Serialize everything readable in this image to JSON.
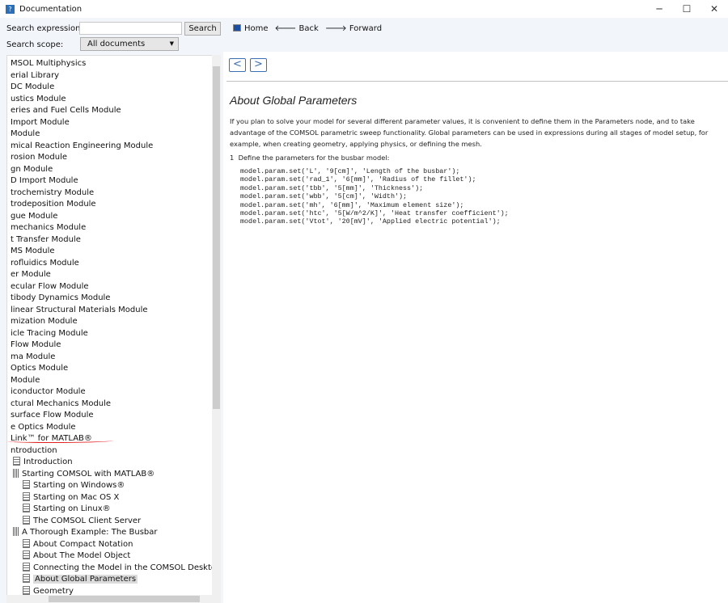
{
  "window": {
    "title": "Documentation",
    "icon": "help-icon",
    "controls": [
      "─",
      "☐",
      "✕"
    ]
  },
  "search": {
    "expression_label": "Search expression:",
    "expression_value": "",
    "button": "Search",
    "scope_label": "Search scope:",
    "scope_value": "All documents"
  },
  "nav": {
    "home": "Home",
    "back": "Back",
    "forward": "Forward",
    "back_arrow": "🡐",
    "forward_arrow": "🡒",
    "prev": "<",
    "next": ">"
  },
  "tree": {
    "items": [
      {
        "label": "MSOL Multiphysics",
        "indent": 0,
        "icon": ""
      },
      {
        "label": "erial Library",
        "indent": 0,
        "icon": ""
      },
      {
        "label": "DC Module",
        "indent": 0,
        "icon": ""
      },
      {
        "label": "ustics Module",
        "indent": 0,
        "icon": ""
      },
      {
        "label": "eries and Fuel Cells Module",
        "indent": 0,
        "icon": ""
      },
      {
        "label": " Import Module",
        "indent": 0,
        "icon": ""
      },
      {
        "label": " Module",
        "indent": 0,
        "icon": ""
      },
      {
        "label": "mical Reaction Engineering Module",
        "indent": 0,
        "icon": ""
      },
      {
        "label": "rosion Module",
        "indent": 0,
        "icon": ""
      },
      {
        "label": "gn Module",
        "indent": 0,
        "icon": ""
      },
      {
        "label": "D Import Module",
        "indent": 0,
        "icon": ""
      },
      {
        "label": "trochemistry Module",
        "indent": 0,
        "icon": ""
      },
      {
        "label": "trodeposition Module",
        "indent": 0,
        "icon": ""
      },
      {
        "label": "gue Module",
        "indent": 0,
        "icon": ""
      },
      {
        "label": "mechanics Module",
        "indent": 0,
        "icon": ""
      },
      {
        "label": "t Transfer Module",
        "indent": 0,
        "icon": ""
      },
      {
        "label": "MS Module",
        "indent": 0,
        "icon": ""
      },
      {
        "label": "rofluidics Module",
        "indent": 0,
        "icon": ""
      },
      {
        "label": "er Module",
        "indent": 0,
        "icon": ""
      },
      {
        "label": "ecular Flow Module",
        "indent": 0,
        "icon": ""
      },
      {
        "label": "tibody Dynamics Module",
        "indent": 0,
        "icon": ""
      },
      {
        "label": "linear Structural Materials Module",
        "indent": 0,
        "icon": ""
      },
      {
        "label": "mization Module",
        "indent": 0,
        "icon": ""
      },
      {
        "label": "icle Tracing Module",
        "indent": 0,
        "icon": ""
      },
      {
        "label": " Flow Module",
        "indent": 0,
        "icon": ""
      },
      {
        "label": "ma Module",
        "indent": 0,
        "icon": ""
      },
      {
        "label": " Optics Module",
        "indent": 0,
        "icon": ""
      },
      {
        "label": "Module",
        "indent": 0,
        "icon": ""
      },
      {
        "label": "iconductor Module",
        "indent": 0,
        "icon": ""
      },
      {
        "label": "ctural Mechanics Module",
        "indent": 0,
        "icon": ""
      },
      {
        "label": "surface Flow Module",
        "indent": 0,
        "icon": ""
      },
      {
        "label": "e Optics Module",
        "indent": 0,
        "icon": ""
      },
      {
        "label": "Link™ for MATLAB®",
        "indent": 0,
        "icon": ""
      },
      {
        "label": "ntroduction",
        "indent": 0,
        "icon": ""
      },
      {
        "label": "Introduction",
        "indent": 1,
        "icon": "doc"
      },
      {
        "label": "Starting COMSOL with MATLAB®",
        "indent": 1,
        "icon": "book"
      },
      {
        "label": "Starting on Windows®",
        "indent": 2,
        "icon": "doc"
      },
      {
        "label": "Starting on Mac OS X",
        "indent": 2,
        "icon": "doc"
      },
      {
        "label": "Starting on Linux®",
        "indent": 2,
        "icon": "doc"
      },
      {
        "label": "The COMSOL Client Server",
        "indent": 2,
        "icon": "doc"
      },
      {
        "label": "A Thorough Example: The Busbar",
        "indent": 1,
        "icon": "book"
      },
      {
        "label": "About Compact Notation",
        "indent": 2,
        "icon": "doc"
      },
      {
        "label": "About The Model Object",
        "indent": 2,
        "icon": "doc"
      },
      {
        "label": "Connecting the Model in the COMSOL Desktop®",
        "indent": 2,
        "icon": "doc"
      },
      {
        "label": "About Global Parameters",
        "indent": 2,
        "icon": "doc",
        "selected": true
      },
      {
        "label": "Geometry",
        "indent": 2,
        "icon": "doc"
      }
    ]
  },
  "content": {
    "title": "About Global Parameters",
    "paragraph": "If you plan to solve your model for several different parameter values, it is convenient to define them in the Parameters node, and to take advantage of the COMSOL parametric sweep functionality. Global parameters can be used in expressions during all stages of model setup, for example, when creating geometry, applying physics, or defining the mesh.",
    "step_number": "1",
    "step_text": "Define the parameters for the busbar model:",
    "code": "model.param.set('L', '9[cm]', 'Length of the busbar');\nmodel.param.set('rad_1', '6[mm]', 'Radius of the fillet');\nmodel.param.set('tbb', '5[mm]', 'Thickness');\nmodel.param.set('wbb', '5[cm]', 'Width');\nmodel.param.set('mh', '6[mm]', 'Maximum element size');\nmodel.param.set('htc', '5[W/m^2/K]', 'Heat transfer coefficient');\nmodel.param.set('Vtot', '20[mV]', 'Applied electric potential');"
  }
}
